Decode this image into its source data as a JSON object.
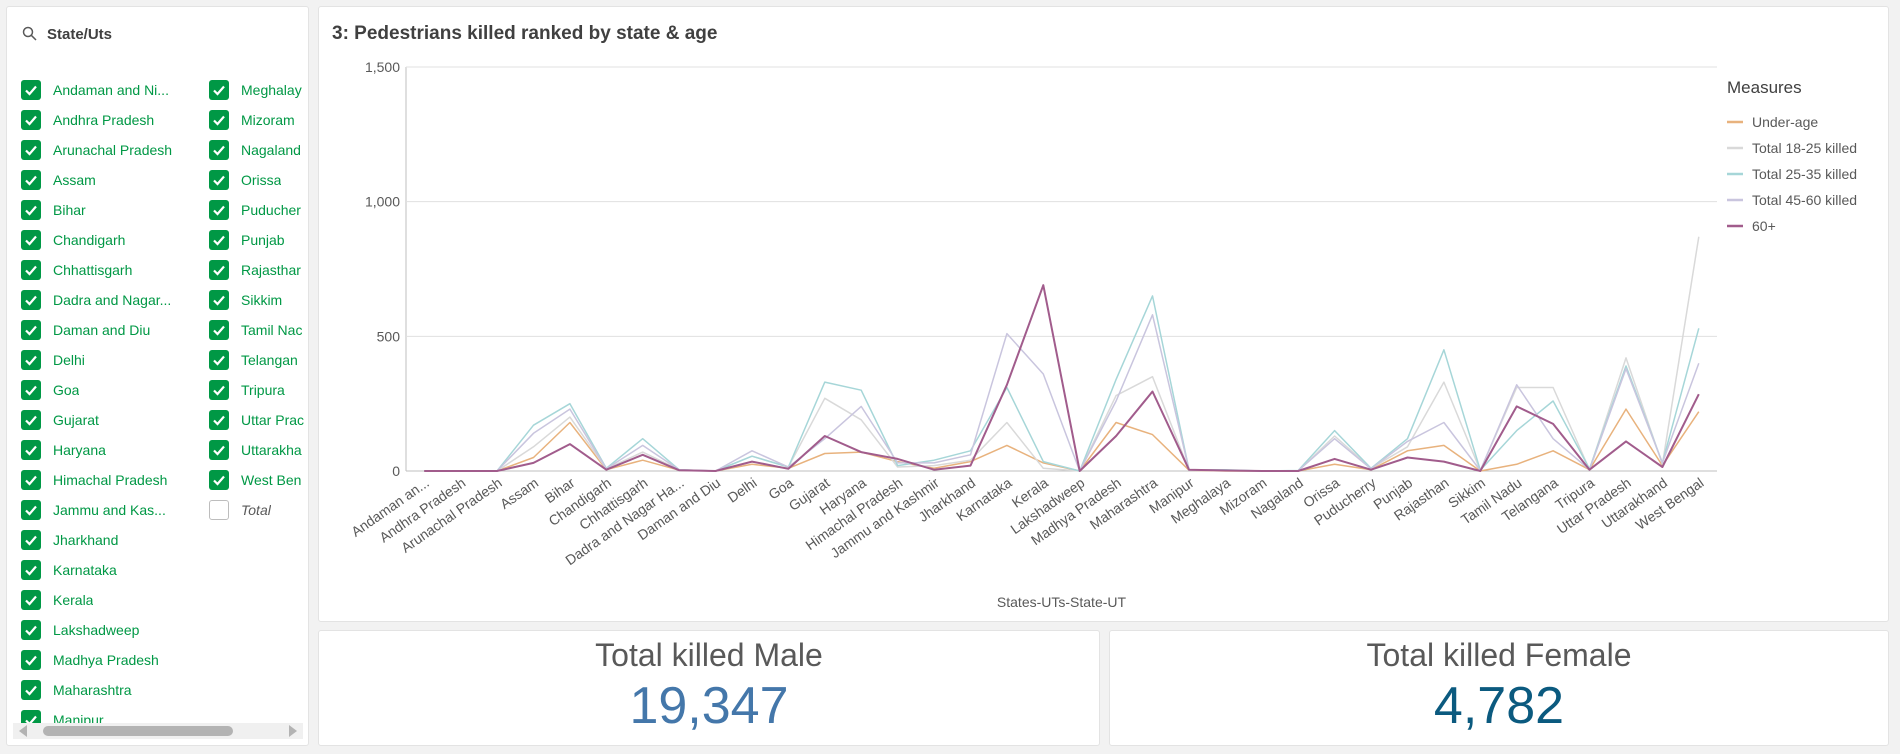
{
  "filter": {
    "title": "State/Uts",
    "col1": [
      {
        "label": "Andaman and Ni...",
        "checked": true
      },
      {
        "label": "Andhra Pradesh",
        "checked": true
      },
      {
        "label": "Arunachal Pradesh",
        "checked": true
      },
      {
        "label": "Assam",
        "checked": true
      },
      {
        "label": "Bihar",
        "checked": true
      },
      {
        "label": "Chandigarh",
        "checked": true
      },
      {
        "label": "Chhattisgarh",
        "checked": true
      },
      {
        "label": "Dadra and Nagar...",
        "checked": true
      },
      {
        "label": "Daman and Diu",
        "checked": true
      },
      {
        "label": "Delhi",
        "checked": true
      },
      {
        "label": "Goa",
        "checked": true
      },
      {
        "label": "Gujarat",
        "checked": true
      },
      {
        "label": "Haryana",
        "checked": true
      },
      {
        "label": "Himachal Pradesh",
        "checked": true
      },
      {
        "label": "Jammu and Kas...",
        "checked": true
      },
      {
        "label": "Jharkhand",
        "checked": true
      },
      {
        "label": "Karnataka",
        "checked": true
      },
      {
        "label": "Kerala",
        "checked": true
      },
      {
        "label": "Lakshadweep",
        "checked": true
      },
      {
        "label": "Madhya Pradesh",
        "checked": true
      },
      {
        "label": "Maharashtra",
        "checked": true
      },
      {
        "label": "Manipur",
        "checked": true
      }
    ],
    "col2": [
      {
        "label": "Meghalay",
        "checked": true
      },
      {
        "label": "Mizoram",
        "checked": true
      },
      {
        "label": "Nagaland",
        "checked": true
      },
      {
        "label": "Orissa",
        "checked": true
      },
      {
        "label": "Puducher",
        "checked": true
      },
      {
        "label": "Punjab",
        "checked": true
      },
      {
        "label": "Rajasthar",
        "checked": true
      },
      {
        "label": "Sikkim",
        "checked": true
      },
      {
        "label": "Tamil Nac",
        "checked": true
      },
      {
        "label": "Telangan",
        "checked": true
      },
      {
        "label": "Tripura",
        "checked": true
      },
      {
        "label": "Uttar Prac",
        "checked": true
      },
      {
        "label": "Uttarakha",
        "checked": true
      },
      {
        "label": "West Ben",
        "checked": true
      },
      {
        "label": "Total",
        "checked": false
      }
    ]
  },
  "chart_title": "3: Pedestrians killed ranked by state & age",
  "chart_data": {
    "type": "line",
    "title": "3: Pedestrians killed ranked by state & age",
    "xlabel": "States-UTs-State-UT",
    "ylabel": "",
    "ylim": [
      0,
      1500
    ],
    "yticks": [
      0,
      500,
      1000,
      1500
    ],
    "ytick_labels": [
      "0",
      "500",
      "1,000",
      "1,500"
    ],
    "grid": true,
    "legend_title": "Measures",
    "legend_position": "right",
    "categories": [
      "Andaman an...",
      "Andhra Pradesh",
      "Arunachal Pradesh",
      "Assam",
      "Bihar",
      "Chandigarh",
      "Chhattisgarh",
      "Dadra and Nagar Ha...",
      "Daman and Diu",
      "Delhi",
      "Goa",
      "Gujarat",
      "Haryana",
      "Himachal Pradesh",
      "Jammu and Kashmir",
      "Jharkhand",
      "Karnataka",
      "Kerala",
      "Lakshadweep",
      "Madhya Pradesh",
      "Maharashtra",
      "Manipur",
      "Meghalaya",
      "Mizoram",
      "Nagaland",
      "Orissa",
      "Puducherry",
      "Punjab",
      "Rajasthan",
      "Sikkim",
      "Tamil Nadu",
      "Telangana",
      "Tripura",
      "Uttar Pradesh",
      "Uttarakhand",
      "West Bengal"
    ],
    "series": [
      {
        "name": "Under-age",
        "color": "#e8b27d",
        "values": [
          0,
          0,
          0,
          50,
          180,
          5,
          40,
          3,
          0,
          25,
          10,
          65,
          70,
          35,
          10,
          35,
          95,
          30,
          0,
          180,
          135,
          3,
          0,
          0,
          0,
          25,
          5,
          75,
          95,
          0,
          25,
          75,
          5,
          230,
          20,
          220
        ]
      },
      {
        "name": "Total 18-25 killed",
        "color": "#d9d9d9",
        "values": [
          0,
          0,
          0,
          90,
          200,
          8,
          70,
          5,
          0,
          55,
          15,
          270,
          190,
          15,
          20,
          40,
          180,
          10,
          0,
          280,
          350,
          3,
          2,
          0,
          0,
          130,
          10,
          90,
          330,
          2,
          310,
          310,
          5,
          420,
          25,
          870
        ]
      },
      {
        "name": "Total 25-35 killed",
        "color": "#a6d6d8",
        "values": [
          0,
          0,
          0,
          170,
          250,
          10,
          120,
          5,
          0,
          55,
          15,
          330,
          300,
          20,
          40,
          75,
          310,
          35,
          0,
          340,
          650,
          5,
          5,
          0,
          2,
          150,
          10,
          120,
          450,
          3,
          150,
          260,
          8,
          390,
          30,
          530
        ]
      },
      {
        "name": "Total 45-60 killed",
        "color": "#c9c5de",
        "values": [
          0,
          0,
          0,
          140,
          230,
          8,
          95,
          5,
          0,
          75,
          15,
          120,
          240,
          30,
          30,
          60,
          510,
          360,
          0,
          260,
          580,
          5,
          3,
          0,
          1,
          120,
          8,
          110,
          180,
          2,
          320,
          120,
          5,
          380,
          30,
          400
        ]
      },
      {
        "name": "60+",
        "color": "#a15c8c",
        "values": [
          0,
          0,
          0,
          30,
          100,
          5,
          60,
          3,
          0,
          35,
          8,
          130,
          70,
          45,
          5,
          20,
          320,
          690,
          0,
          130,
          295,
          5,
          2,
          0,
          0,
          45,
          5,
          50,
          35,
          0,
          240,
          175,
          5,
          110,
          15,
          285
        ]
      }
    ]
  },
  "kpis": {
    "male": {
      "title": "Total killed Male",
      "value": "19,347",
      "color": "#4477aa"
    },
    "female": {
      "title": "Total killed Female",
      "value": "4,782",
      "color": "#0b5a7f"
    }
  }
}
